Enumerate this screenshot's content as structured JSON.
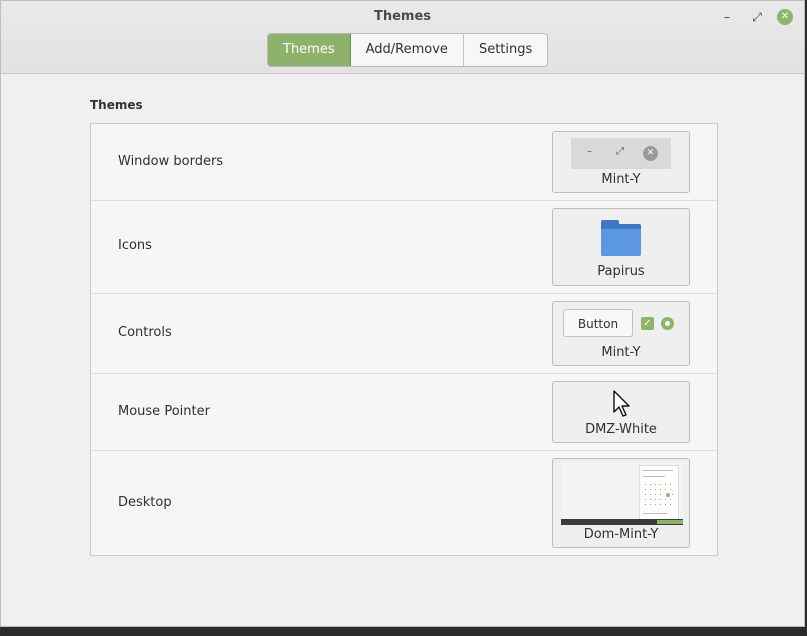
{
  "window": {
    "title": "Themes"
  },
  "tabs": [
    {
      "label": "Themes",
      "active": true
    },
    {
      "label": "Add/Remove",
      "active": false
    },
    {
      "label": "Settings",
      "active": false
    }
  ],
  "section_title": "Themes",
  "rows": [
    {
      "label": "Window borders",
      "value": "Mint-Y"
    },
    {
      "label": "Icons",
      "value": "Papirus"
    },
    {
      "label": "Controls",
      "value": "Mint-Y",
      "button_text": "Button"
    },
    {
      "label": "Mouse Pointer",
      "value": "DMZ-White"
    },
    {
      "label": "Desktop",
      "value": "Dom-Mint-Y"
    }
  ],
  "icons": {
    "minimize": "minimize-icon",
    "maximize": "maximize-icon",
    "close": "close-icon",
    "folder": "folder-icon",
    "cursor": "cursor-icon",
    "check": "check-icon"
  },
  "colors": {
    "accent": "#8fb26b",
    "folder": "#5b97e2"
  }
}
